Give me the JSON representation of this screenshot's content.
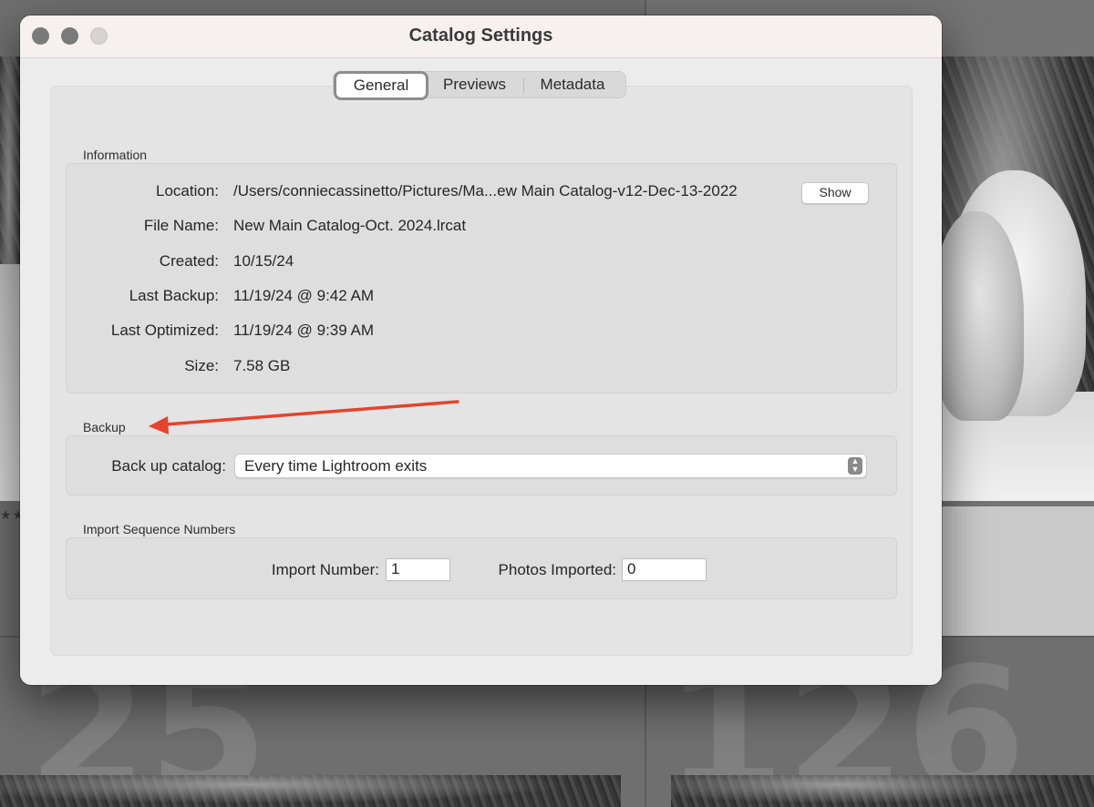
{
  "window": {
    "title": "Catalog Settings"
  },
  "tabs": [
    {
      "label": "General",
      "active": true
    },
    {
      "label": "Previews",
      "active": false
    },
    {
      "label": "Metadata",
      "active": false
    }
  ],
  "information": {
    "section_label": "Information",
    "rows": [
      {
        "label": "Location:",
        "value": "/Users/conniecassinetto/Pictures/Ma...ew Main Catalog-v12-Dec-13-2022"
      },
      {
        "label": "File Name:",
        "value": "New Main Catalog-Oct. 2024.lrcat"
      },
      {
        "label": "Created:",
        "value": "10/15/24"
      },
      {
        "label": "Last Backup:",
        "value": "11/19/24 @ 9:42 AM"
      },
      {
        "label": "Last Optimized:",
        "value": "11/19/24 @ 9:39 AM"
      },
      {
        "label": "Size:",
        "value": "7.58 GB"
      }
    ],
    "show_button": "Show"
  },
  "backup": {
    "section_label": "Backup",
    "field_label": "Back up catalog:",
    "selected_option": "Every time Lightroom exits"
  },
  "import_sequence": {
    "section_label": "Import Sequence Numbers",
    "import_number_label": "Import Number:",
    "import_number_value": "1",
    "photos_imported_label": "Photos Imported:",
    "photos_imported_value": "0"
  },
  "background": {
    "cell_numbers": [
      "25",
      "126"
    ],
    "rating": "★★"
  },
  "colors": {
    "annotation_arrow": "#e5432b",
    "dialog_bg": "#ececec",
    "titlebar_bg": "#f6f1ee"
  }
}
